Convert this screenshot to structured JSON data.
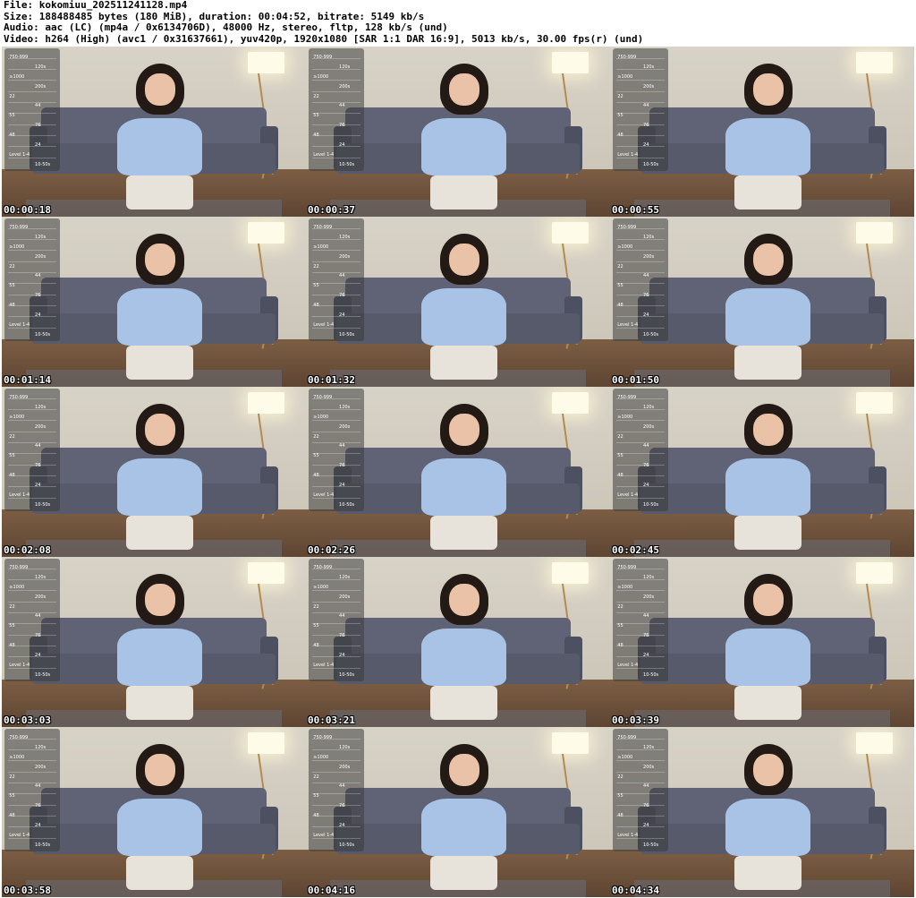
{
  "header": {
    "file": "File: kokomiuu_202511241128.mp4",
    "size": "Size: 188488485 bytes (180 MiB), duration: 00:04:52, bitrate: 5149 kb/s",
    "audio": "Audio: aac (LC) (mp4a / 0x6134706D), 48000 Hz, stereo, fltp, 128 kb/s (und)",
    "video": "Video: h264 (High) (avc1 / 0x31637661), yuv420p, 1920x1080 [SAR 1:1 DAR 16:9], 5013 kb/s, 30.00 fps(r) (und)"
  },
  "thumbnails": [
    {
      "timestamp": "00:00:18"
    },
    {
      "timestamp": "00:00:37"
    },
    {
      "timestamp": "00:00:55"
    },
    {
      "timestamp": "00:01:14"
    },
    {
      "timestamp": "00:01:32"
    },
    {
      "timestamp": "00:01:50"
    },
    {
      "timestamp": "00:02:08"
    },
    {
      "timestamp": "00:02:26"
    },
    {
      "timestamp": "00:02:45"
    },
    {
      "timestamp": "00:03:03"
    },
    {
      "timestamp": "00:03:21"
    },
    {
      "timestamp": "00:03:39"
    },
    {
      "timestamp": "00:03:58"
    },
    {
      "timestamp": "00:04:16"
    },
    {
      "timestamp": "00:04:34"
    }
  ],
  "overlay_labels": [
    "750-999",
    "120s",
    "≥1000",
    "200s",
    "22",
    "44",
    "55",
    "76",
    "48",
    "24",
    "Level 1-4",
    "10-50s"
  ],
  "colors": {
    "background": "#ffffff",
    "header_text": "#000000",
    "timestamp_text": "#ffffff",
    "shirt": "#a9c3e6",
    "couch": "#5f6375"
  }
}
